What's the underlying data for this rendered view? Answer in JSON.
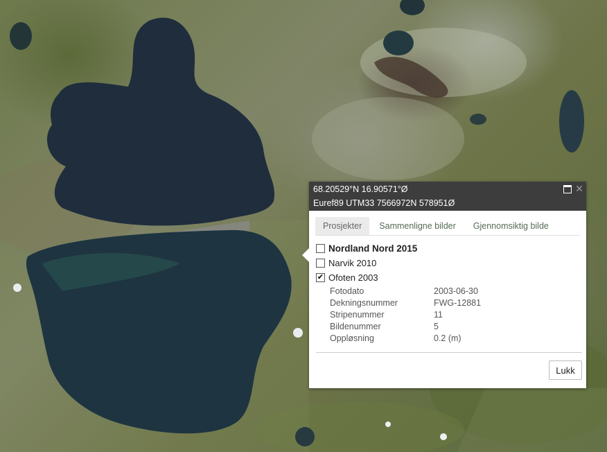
{
  "popup": {
    "coords_line1": "68.20529°N 16.90571°Ø",
    "coords_line2": "Euref89 UTM33 7566972N 578951Ø",
    "tabs": [
      {
        "label": "Prosjekter",
        "active": true
      },
      {
        "label": "Sammenligne bilder",
        "active": false
      },
      {
        "label": "Gjennomsiktig bilde",
        "active": false
      }
    ],
    "projects": [
      {
        "label": "Nordland Nord 2015",
        "checked": false,
        "bold": true
      },
      {
        "label": "Narvik 2010",
        "checked": false,
        "bold": false
      },
      {
        "label": "Ofoten 2003",
        "checked": true,
        "bold": false
      }
    ],
    "details": [
      {
        "key": "Fotodato",
        "value": "2003-06-30"
      },
      {
        "key": "Dekningsnummer",
        "value": "FWG-12881"
      },
      {
        "key": "Stripenummer",
        "value": "11"
      },
      {
        "key": "Bildenummer",
        "value": "5"
      },
      {
        "key": "Oppløsning",
        "value": "0.2 (m)"
      }
    ],
    "close_label": "Lukk",
    "checkmark": "✔",
    "close_icon": "✕"
  },
  "colors": {
    "header_bg": "#3d3d3d",
    "water": "#1f2d3d",
    "land": "#6e7a4c"
  }
}
